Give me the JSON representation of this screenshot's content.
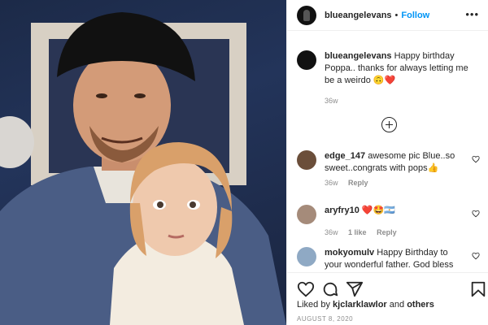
{
  "post": {
    "username": "blueangelevans",
    "follow_label": "Follow",
    "separator": "•"
  },
  "caption": {
    "username": "blueangelevans",
    "text": "Happy birthday Poppa.. thanks for always letting me be a weirdo 🙃❤️",
    "time": "36w"
  },
  "comments": [
    {
      "username": "edge_147",
      "text": "awesome pic Blue..so sweet..congrats with pops👍",
      "time": "36w",
      "likes": "",
      "reply": "Reply",
      "avatar_color": "#6b4e3a"
    },
    {
      "username": "aryfry10",
      "text": "❤️🤩🇦🇷",
      "time": "36w",
      "likes": "1 like",
      "reply": "Reply",
      "avatar_color": "#a58b7a"
    },
    {
      "username": "mokyomulv",
      "text": "Happy Birthday to your wonderful father. God bless",
      "time": "",
      "likes": "",
      "reply": "",
      "avatar_color": "#8fa9c4"
    }
  ],
  "likes": {
    "prefix": "Liked by",
    "user": "kjclarklawlor",
    "conjunction": "and",
    "others": "others"
  },
  "date": "AUGUST 8, 2020",
  "icons": {
    "more": "more-options-icon",
    "load_more": "plus-circle-icon",
    "like": "heart-icon",
    "comment": "comment-icon",
    "share": "share-icon",
    "save": "bookmark-icon"
  }
}
